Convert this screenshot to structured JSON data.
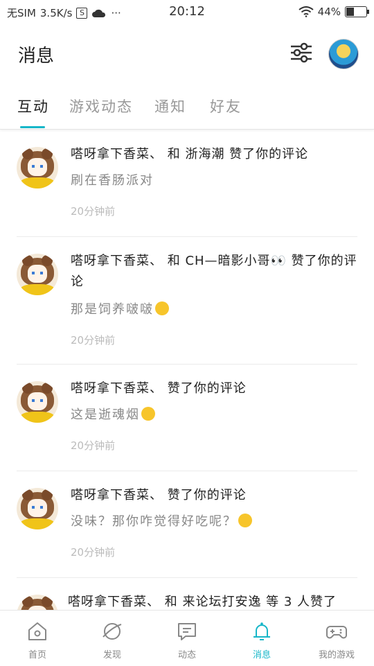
{
  "status_bar": {
    "carrier": "无SIM",
    "speed": "3.5K/s",
    "sim_icon_text": "S",
    "dots": "···",
    "time": "20:12",
    "battery_percent": "44%",
    "battery_level": 0.44
  },
  "header": {
    "title": "消息",
    "filter_icon": "sliders-icon",
    "avatar_icon": "user-avatar"
  },
  "tabs": [
    {
      "label": "互动",
      "active": true
    },
    {
      "label": "游戏动态",
      "active": false
    },
    {
      "label": "通知",
      "active": false
    },
    {
      "label": "好友",
      "active": false
    }
  ],
  "notifications": [
    {
      "title": "嗒呀拿下香菜、 和 浙海潮 赞了你的评论",
      "comment": "刷在香肠派对",
      "time": "20分钟前"
    },
    {
      "title": "嗒呀拿下香菜、 和 CH—暗影小哥👀 赞了你的评论",
      "comment": "那是饲养啵啵",
      "time": "20分钟前"
    },
    {
      "title": "嗒呀拿下香菜、 赞了你的评论",
      "comment": "这是逝魂烟",
      "time": "20分钟前"
    },
    {
      "title": "嗒呀拿下香菜、 赞了你的评论",
      "comment": "没味？那你咋觉得好吃呢？",
      "time": "20分钟前"
    },
    {
      "title": "嗒呀拿下香菜、 和 来论坛打安逸 等 3 人赞了",
      "comment": "",
      "time": ""
    }
  ],
  "bottom_nav": [
    {
      "label": "首页",
      "icon": "home-icon",
      "active": false
    },
    {
      "label": "发现",
      "icon": "planet-icon",
      "active": false
    },
    {
      "label": "动态",
      "icon": "chat-icon",
      "active": false
    },
    {
      "label": "消息",
      "icon": "bell-icon",
      "active": true
    },
    {
      "label": "我的游戏",
      "icon": "gamepad-icon",
      "active": false
    }
  ],
  "colors": {
    "accent": "#16b6c8",
    "text_primary": "#222222",
    "text_secondary": "#888888",
    "text_time": "#bbbbbb"
  }
}
